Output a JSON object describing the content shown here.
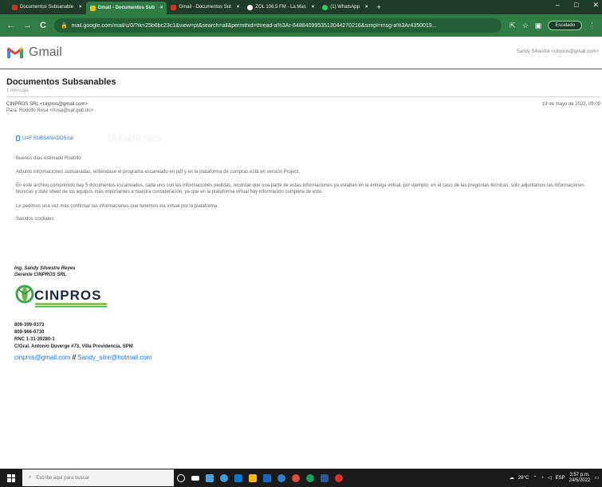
{
  "browser": {
    "tabs": [
      {
        "label": "Documentos Subsanable",
        "favicon_color": "#d93025",
        "active": false
      },
      {
        "label": "Gmail - Documentos Sub",
        "favicon_color": "#d93025",
        "active": true
      },
      {
        "label": "Gmail - Documentos Sut",
        "favicon_color": "#d93025",
        "active": false
      },
      {
        "label": "ZOL 106.5 FM - La Mas",
        "favicon_color": "#ffffff",
        "active": false
      },
      {
        "label": "(1) WhatsApp",
        "favicon_color": "#25d366",
        "active": false
      }
    ],
    "url": "mail.google.com/mail/u/0/?ik=25b6bc23c1&view=pt&search=all&permthid=thread-a%3Ar-6488409953513044270216&simpl=msg-a%3Ar4350019...",
    "profile_label": "Escalado"
  },
  "gmail": {
    "product_name": "Gmail",
    "account": "Sandy Silvestre <cinpros@gmail.com>"
  },
  "message": {
    "subject": "Documentos Subsanables",
    "count": "1 mensaje",
    "from": "CINPROS SRL <cinpros@gmail.com>",
    "to": "Para: Rodolfo Rosa <rrosa@uaf.gob.do>",
    "date": "19 de mayo de 2022, 09:09",
    "attachment": "UAF SUBSANADOS.rar",
    "attachment_ghost": "Documentos",
    "body": [
      "Buenos días estimado Rodolfo",
      "Adjunto informaciones subsanadas, entiéndase el programa escaneado en pdf y en la plataforma de compras está en versión Project.",
      "En este archivo comprimido hay 5 documentos escaneados, cada uno con las informaciones pedidas, recordar que una parte de estas informaciones ya estaban en la entrega virtual, por ejemplo, en el caso de las preguntas técnicas, solo adjuntamos las informaciones técnicas y daté sheet de los equipos más importantes a nuestra consideración, ya que en la plataforma virtual hay información completa de esto.",
      "Le pedimos una vez más confirmar las informaciones que tenemos vía virtual por la plataforma.",
      "Saludos cordiales."
    ]
  },
  "signature": {
    "name": "Ing. Sandy Silvestre Reyes",
    "role": "Gerente CINPROS SRL",
    "logo_text": "CINPROS",
    "phone1": "809-399-9373",
    "phone2": "809-966-0730",
    "rnc": "RNC 1-31-39280-1",
    "address": "C/Gral. Antonio Duverge #73, Villa Providencia, SPM",
    "email1": "cinpros@gmail.com",
    "separator": " // ",
    "email2": "Sandy_silre@hotmail.com"
  },
  "taskbar": {
    "search_placeholder": "Escribe aquí para buscar",
    "apps": [
      "#ffffff",
      "#4aa3df",
      "#3aa0e6",
      "#0078d4",
      "#ffb900",
      "#0f6cbd",
      "#2d7dd2",
      "#e04a3a",
      "#1aa260",
      "#2b579a",
      "#d93025"
    ],
    "weather": "28°C",
    "lang": "ESP",
    "time": "3:57 p.m.",
    "date": "24/5/2022"
  }
}
